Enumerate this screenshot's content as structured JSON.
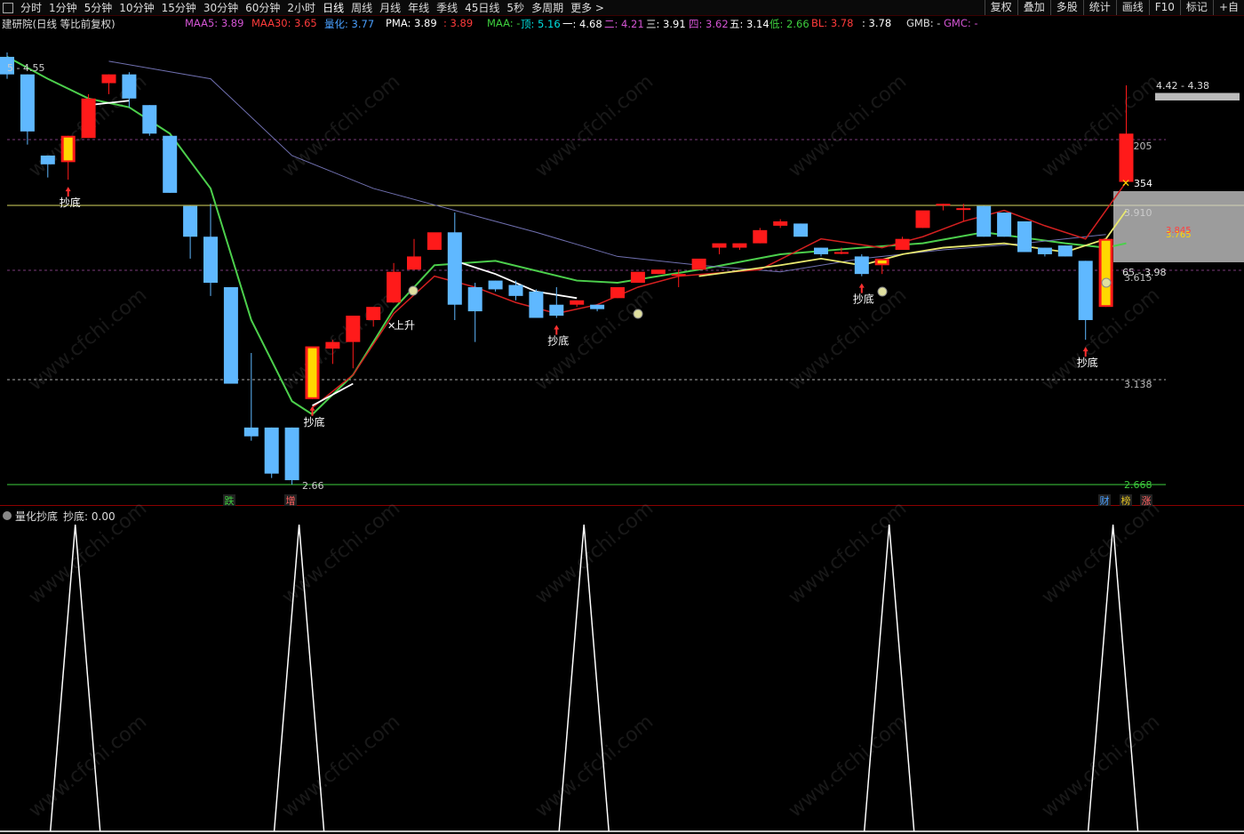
{
  "toolbar": {
    "periods": [
      "分时",
      "1分钟",
      "5分钟",
      "10分钟",
      "15分钟",
      "30分钟",
      "60分钟",
      "2小时",
      "日线",
      "周线",
      "月线",
      "年线",
      "季线",
      "45日线",
      "5秒",
      "多周期",
      "更多 >"
    ],
    "active": "日线",
    "right_buttons": [
      "复权",
      "叠加",
      "多股",
      "统计",
      "画线",
      "F10",
      "标记",
      "+自"
    ]
  },
  "chart_title": "建研院(日线 等比前复权)",
  "legend": [
    {
      "label": "MAA5: 3.89",
      "color": "#d455d4"
    },
    {
      "label": "MAA30: 3.65",
      "color": "#ff3b3b"
    },
    {
      "label": "量化: 3.77",
      "color": "#4aa0ff"
    },
    {
      "label": "PMA: 3.89",
      "color": "#ffffff"
    },
    {
      "label": ": 3.89",
      "color": "#ff3b3b"
    },
    {
      "label": "MAA: -",
      "color": "#3ecf3e"
    },
    {
      "label": "顶: 5.16",
      "color": "#00e0e0"
    },
    {
      "label": "一: 4.68",
      "color": "#ffffff"
    },
    {
      "label": "二: 4.21",
      "color": "#d455d4"
    },
    {
      "label": "三: 3.91",
      "color": "#ffffff"
    },
    {
      "label": "四: 3.62",
      "color": "#d455d4"
    },
    {
      "label": "五: 3.14",
      "color": "#ffffff"
    },
    {
      "label": "低: 2.66",
      "color": "#3ecf3e"
    },
    {
      "label": "BL: 3.78",
      "color": "#ff3b3b"
    },
    {
      "label": ": 3.78",
      "color": "#ffffff"
    },
    {
      "label": "GMB: -",
      "color": "#dddddd"
    },
    {
      "label": "GMC: -",
      "color": "#d455d4"
    }
  ],
  "price_levels": {
    "top": "4.205",
    "l1": "3.910",
    "l2": "3.615",
    "l3": "3.138",
    "low": "2.668"
  },
  "annotations": {
    "hi_label": "4.42 - 4.38",
    "left_label": "5 - 4.55",
    "low_label": "2.66",
    "mark_354": "354",
    "buy_label": "抄底",
    "rise_label": "上升",
    "right_mid": "65 - 3.98",
    "ma_y1": "3.765",
    "ma_y2": "3.845",
    "bottom_tags": [
      {
        "t": "跌",
        "c": "#3ecf3e"
      },
      {
        "t": "增",
        "c": "#ff6060"
      },
      {
        "t": "财",
        "c": "#4aa0ff"
      },
      {
        "t": "榜",
        "c": "#e0c020"
      },
      {
        "t": "涨",
        "c": "#ff6060"
      }
    ]
  },
  "indicator": {
    "name": "量化抄底",
    "value_label": "抄底: 0.00"
  },
  "colors": {
    "up": "#ff1a1a",
    "down": "#5fb8ff",
    "gold": "#ffd700",
    "green": "#4ccf4c",
    "redline": "#d42020",
    "grid": "#7a3a7a",
    "yellow": "#e8e870"
  },
  "candles": [
    {
      "o": 4.55,
      "h": 4.57,
      "l": 4.45,
      "c": 4.47
    },
    {
      "o": 4.47,
      "h": 4.47,
      "l": 4.15,
      "c": 4.21
    },
    {
      "o": 4.1,
      "h": 4.1,
      "l": 4.0,
      "c": 4.06
    },
    {
      "o": 4.07,
      "h": 4.19,
      "l": 3.99,
      "c": 4.19
    },
    {
      "o": 4.18,
      "h": 4.38,
      "l": 4.18,
      "c": 4.36
    },
    {
      "o": 4.43,
      "h": 4.47,
      "l": 4.38,
      "c": 4.47
    },
    {
      "o": 4.47,
      "h": 4.48,
      "l": 4.32,
      "c": 4.36
    },
    {
      "o": 4.33,
      "h": 4.33,
      "l": 4.19,
      "c": 4.2
    },
    {
      "o": 4.19,
      "h": 4.19,
      "l": 3.93,
      "c": 3.93
    },
    {
      "o": 3.87,
      "h": 3.87,
      "l": 3.63,
      "c": 3.73
    },
    {
      "o": 3.73,
      "h": 3.88,
      "l": 3.46,
      "c": 3.52
    },
    {
      "o": 3.5,
      "h": 3.5,
      "l": 3.06,
      "c": 3.06
    },
    {
      "o": 2.86,
      "h": 3.2,
      "l": 2.8,
      "c": 2.82
    },
    {
      "o": 2.86,
      "h": 2.86,
      "l": 2.63,
      "c": 2.65
    },
    {
      "o": 2.86,
      "h": 2.86,
      "l": 2.6,
      "c": 2.62
    },
    {
      "o": 2.99,
      "h": 3.2,
      "l": 2.99,
      "c": 3.23
    },
    {
      "o": 3.22,
      "h": 3.26,
      "l": 3.15,
      "c": 3.25
    },
    {
      "o": 3.25,
      "h": 3.36,
      "l": 3.13,
      "c": 3.37
    },
    {
      "o": 3.35,
      "h": 3.37,
      "l": 3.32,
      "c": 3.41
    },
    {
      "o": 3.43,
      "h": 3.61,
      "l": 3.43,
      "c": 3.57
    },
    {
      "o": 3.58,
      "h": 3.72,
      "l": 3.58,
      "c": 3.64
    },
    {
      "o": 3.67,
      "h": 3.71,
      "l": 3.67,
      "c": 3.75
    },
    {
      "o": 3.75,
      "h": 3.84,
      "l": 3.35,
      "c": 3.42
    },
    {
      "o": 3.5,
      "h": 3.52,
      "l": 3.25,
      "c": 3.39
    },
    {
      "o": 3.53,
      "h": 3.53,
      "l": 3.48,
      "c": 3.49
    },
    {
      "o": 3.51,
      "h": 3.53,
      "l": 3.44,
      "c": 3.46
    },
    {
      "o": 3.48,
      "h": 3.49,
      "l": 3.36,
      "c": 3.36
    },
    {
      "o": 3.42,
      "h": 3.5,
      "l": 3.36,
      "c": 3.37
    },
    {
      "o": 3.42,
      "h": 3.44,
      "l": 3.41,
      "c": 3.44
    },
    {
      "o": 3.42,
      "h": 3.42,
      "l": 3.39,
      "c": 3.4
    },
    {
      "o": 3.45,
      "h": 3.5,
      "l": 3.45,
      "c": 3.5
    },
    {
      "o": 3.52,
      "h": 3.55,
      "l": 3.52,
      "c": 3.57
    },
    {
      "o": 3.56,
      "h": 3.57,
      "l": 3.56,
      "c": 3.58
    },
    {
      "o": 3.56,
      "h": 3.58,
      "l": 3.5,
      "c": 3.56
    },
    {
      "o": 3.58,
      "h": 3.62,
      "l": 3.58,
      "c": 3.63
    },
    {
      "o": 3.68,
      "h": 3.68,
      "l": 3.65,
      "c": 3.7
    },
    {
      "o": 3.68,
      "h": 3.7,
      "l": 3.67,
      "c": 3.7
    },
    {
      "o": 3.7,
      "h": 3.77,
      "l": 3.7,
      "c": 3.76
    },
    {
      "o": 3.78,
      "h": 3.81,
      "l": 3.77,
      "c": 3.8
    },
    {
      "o": 3.79,
      "h": 3.79,
      "l": 3.75,
      "c": 3.73
    },
    {
      "o": 3.68,
      "h": 3.68,
      "l": 3.64,
      "c": 3.65
    },
    {
      "o": 3.66,
      "h": 3.68,
      "l": 3.65,
      "c": 3.66
    },
    {
      "o": 3.64,
      "h": 3.65,
      "l": 3.55,
      "c": 3.56
    },
    {
      "o": 3.6,
      "h": 3.6,
      "l": 3.56,
      "c": 3.63
    },
    {
      "o": 3.67,
      "h": 3.73,
      "l": 3.67,
      "c": 3.72
    },
    {
      "o": 3.77,
      "h": 3.82,
      "l": 3.77,
      "c": 3.85
    },
    {
      "o": 3.88,
      "h": 3.88,
      "l": 3.85,
      "c": 3.88
    },
    {
      "o": 3.86,
      "h": 3.88,
      "l": 3.8,
      "c": 3.86
    },
    {
      "o": 3.87,
      "h": 3.87,
      "l": 3.73,
      "c": 3.73
    },
    {
      "o": 3.84,
      "h": 3.84,
      "l": 3.73,
      "c": 3.73
    },
    {
      "o": 3.8,
      "h": 3.8,
      "l": 3.66,
      "c": 3.66
    },
    {
      "o": 3.68,
      "h": 3.68,
      "l": 3.64,
      "c": 3.65
    },
    {
      "o": 3.69,
      "h": 3.69,
      "l": 3.64,
      "c": 3.64
    },
    {
      "o": 3.62,
      "h": 3.62,
      "l": 3.26,
      "c": 3.35
    },
    {
      "o": 3.41,
      "h": 3.72,
      "l": 3.41,
      "c": 3.72
    },
    {
      "o": 3.98,
      "h": 4.42,
      "l": 3.98,
      "c": 4.2
    }
  ],
  "buy_points": [
    3,
    15,
    27,
    42,
    53
  ],
  "indicator_peaks": [
    3,
    14,
    28,
    43,
    54
  ]
}
